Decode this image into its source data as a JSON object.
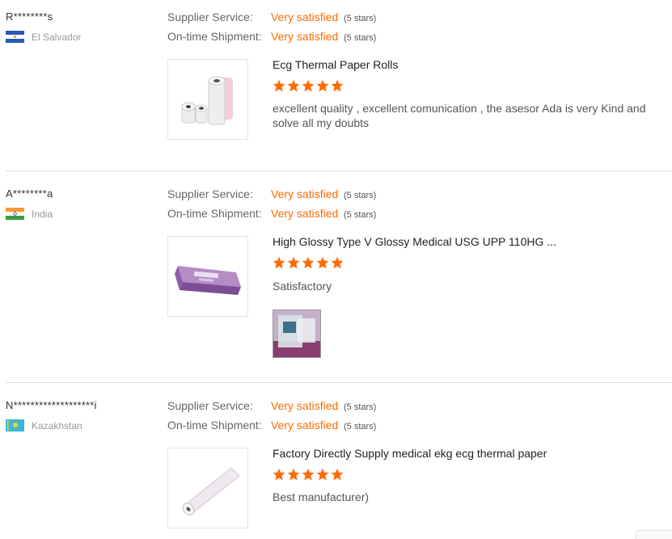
{
  "colors": {
    "accent": "#ff6a00",
    "muted": "#999999",
    "divider": "#dedede"
  },
  "labels": {
    "supplier_service": "Supplier Service:",
    "ontime_shipment": "On-time Shipment:"
  },
  "reviews": [
    {
      "user": "R********s",
      "country": "El Salvador",
      "flag_icon": "el-salvador-flag-icon",
      "supplier_value": "Very satisfied",
      "supplier_stars": "(5 stars)",
      "shipment_value": "Very satisfied",
      "shipment_stars": "(5 stars)",
      "product_title": "Ecg Thermal Paper Rolls",
      "rating": 5,
      "comment": "excellent quality ,  excellent comunication , the asesor Ada is very Kind and solve all my doubts"
    },
    {
      "user": "A********a",
      "country": "India",
      "flag_icon": "india-flag-icon",
      "supplier_value": "Very satisfied",
      "supplier_stars": "(5 stars)",
      "shipment_value": "Very satisfied",
      "shipment_stars": "(5 stars)",
      "product_title": "High Glossy Type V Glossy Medical USG UPP 110HG ...",
      "rating": 5,
      "comment": "Satisfactory"
    },
    {
      "user": "N*******************i",
      "country": "Kazakhstan",
      "flag_icon": "kazakhstan-flag-icon",
      "supplier_value": "Very satisfied",
      "supplier_stars": "(5 stars)",
      "shipment_value": "Very satisfied",
      "shipment_stars": "(5 stars)",
      "product_title": "Factory Directly Supply medical ekg ecg thermal paper",
      "rating": 5,
      "comment": "Best manufacturer)"
    }
  ]
}
